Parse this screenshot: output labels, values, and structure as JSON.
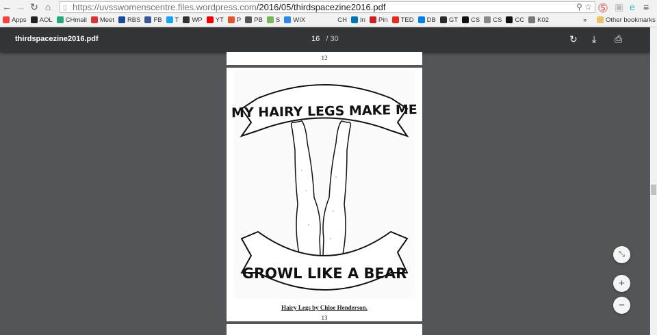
{
  "browser": {
    "url_host": "https://uvsswomenscentre.files.wordpress.com",
    "url_path": "/2016/05/thirdspacezine2016.pdf"
  },
  "bookmarks": [
    {
      "label": "Apps",
      "color": "#e44"
    },
    {
      "label": "AOL",
      "color": "#222"
    },
    {
      "label": "CHmail",
      "color": "#2a7"
    },
    {
      "label": "Meet",
      "color": "#d33"
    },
    {
      "label": "RBS",
      "color": "#1a4a9a"
    },
    {
      "label": "FB",
      "color": "#3b5998"
    },
    {
      "label": "T",
      "color": "#1da1f2"
    },
    {
      "label": "WP",
      "color": "#333"
    },
    {
      "label": "YT",
      "color": "#e00"
    },
    {
      "label": "P",
      "color": "#e5532d"
    },
    {
      "label": "PB",
      "color": "#555"
    },
    {
      "label": "S",
      "color": "#7ab55c"
    },
    {
      "label": "WIX",
      "color": "#2b8ae6"
    },
    {
      "label": "CH",
      "color": "#f2f2f2"
    },
    {
      "label": "In",
      "color": "#0077b5"
    },
    {
      "label": "Pin",
      "color": "#cb2027"
    },
    {
      "label": "TED",
      "color": "#e62b1e"
    },
    {
      "label": "DB",
      "color": "#007ee5"
    },
    {
      "label": "GT",
      "color": "#2a2a2a"
    },
    {
      "label": "CS",
      "color": "#111"
    },
    {
      "label": "CS",
      "color": "#888"
    },
    {
      "label": "CC",
      "color": "#111"
    },
    {
      "label": "K02",
      "color": "#777"
    }
  ],
  "overflow": "»",
  "other_bookmarks": "Other bookmarks",
  "pdf": {
    "title": "thirdspacezine2016.pdf",
    "current_page": "16",
    "separator": "/",
    "total_pages": "30"
  },
  "pages": {
    "prev_number": "12",
    "number": "13",
    "caption": "Hairy Legs by Chloe Henderson.",
    "art_top": "MY HAIRY LEGS MAKE ME",
    "art_bottom": "GROWL LIKE A BEAR"
  }
}
